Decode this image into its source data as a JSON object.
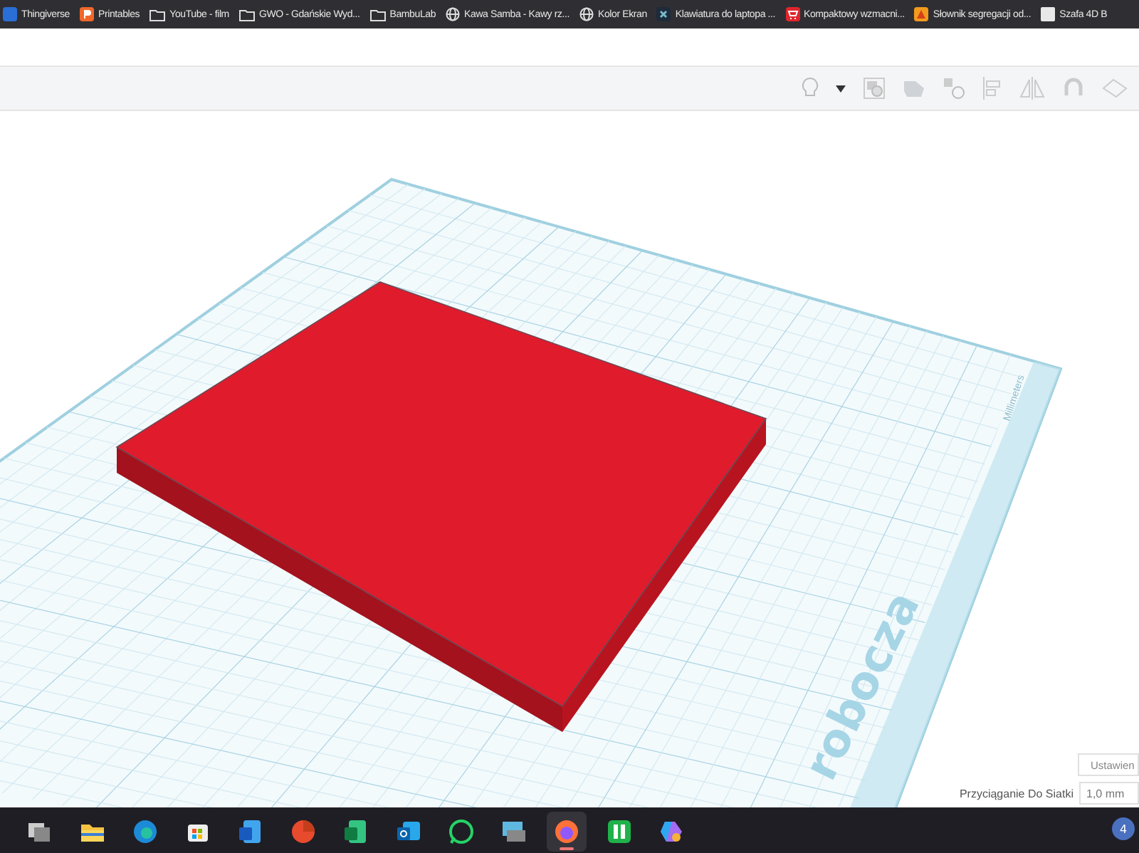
{
  "bookmarks": [
    {
      "label": "Thingiverse",
      "kind": "edge"
    },
    {
      "label": "Printables",
      "kind": "orange"
    },
    {
      "label": "YouTube - film",
      "kind": "folder"
    },
    {
      "label": "GWO - Gdańskie Wyd...",
      "kind": "folder"
    },
    {
      "label": "BambuLab",
      "kind": "folder"
    },
    {
      "label": "Kawa Samba - Kawy rz...",
      "kind": "globe"
    },
    {
      "label": "Kolor Ekran",
      "kind": "globe"
    },
    {
      "label": "Klawiatura do laptopa ...",
      "kind": "cross"
    },
    {
      "label": "Kompaktowy wzmacni...",
      "kind": "cart"
    },
    {
      "label": "Słownik segregacji od...",
      "kind": "flame"
    },
    {
      "label": "Szafa 4D B",
      "kind": "page"
    }
  ],
  "workplane": {
    "label": "robocza",
    "units": "Millimeters"
  },
  "settings": {
    "button": "Ustawien",
    "snap_label": "Przyciąganie Do Siatki",
    "snap_value": "1,0 mm"
  },
  "taskbar": {
    "apps": [
      {
        "kind": "windows",
        "selected": false
      },
      {
        "kind": "folder",
        "selected": false
      },
      {
        "kind": "edge",
        "selected": false
      },
      {
        "kind": "store",
        "selected": false
      },
      {
        "kind": "word",
        "selected": false
      },
      {
        "kind": "pdf",
        "selected": false
      },
      {
        "kind": "sheet",
        "selected": false
      },
      {
        "kind": "mail",
        "selected": false
      },
      {
        "kind": "chat",
        "selected": false
      },
      {
        "kind": "remote",
        "selected": false
      },
      {
        "kind": "firefox",
        "selected": true
      },
      {
        "kind": "grid",
        "selected": false
      },
      {
        "kind": "copilot",
        "selected": false
      }
    ],
    "tray_badge": "4"
  }
}
